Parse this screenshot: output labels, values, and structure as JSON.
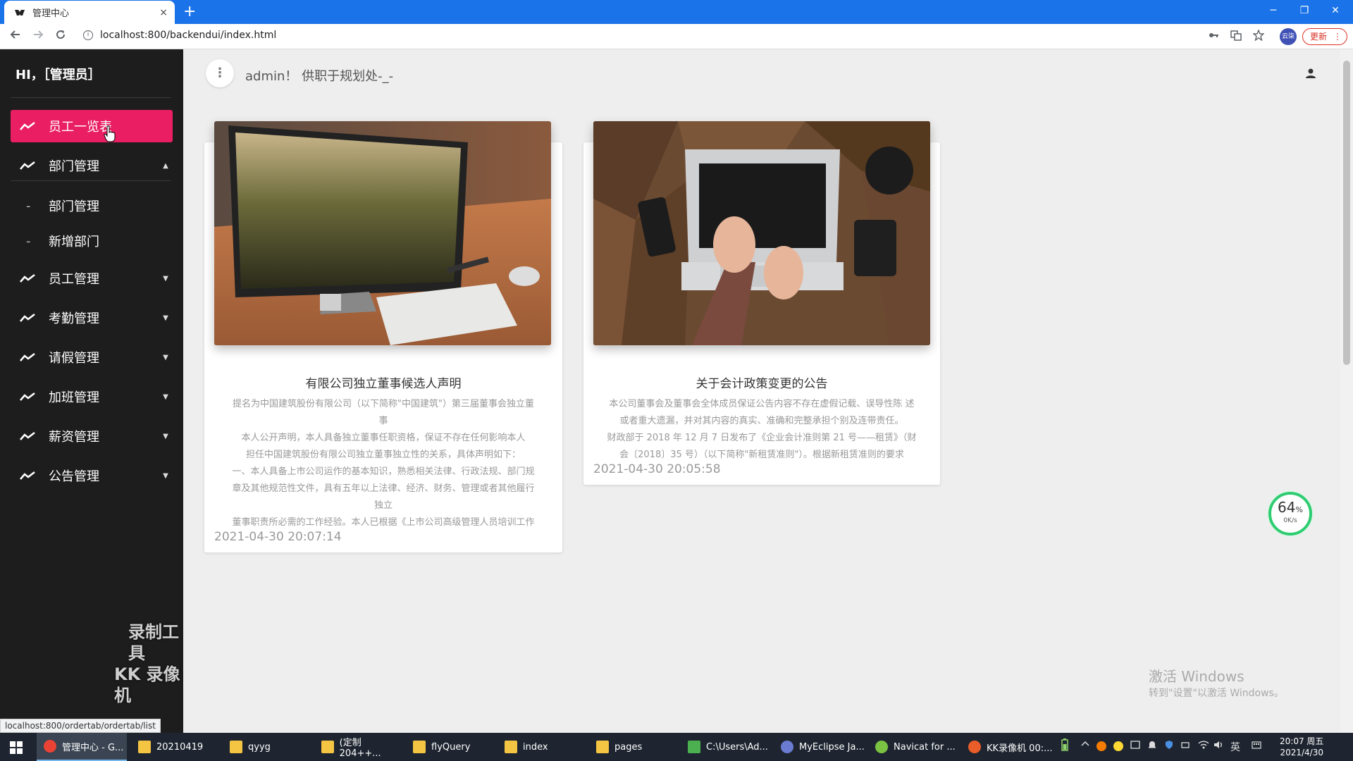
{
  "browser": {
    "tab_title": "管理中心",
    "close_glyph": "×",
    "new_tab_glyph": "+",
    "url": "localhost:800/backendui/index.html",
    "profile_text": "云柒",
    "update_label": "更新",
    "window_controls": [
      "─",
      "❐",
      "✕"
    ]
  },
  "sidebar": {
    "greeting": "HI，［管理员］",
    "items": [
      {
        "label": "员工一览表",
        "active": true,
        "caret": ""
      },
      {
        "label": "部门管理",
        "caret": "▲"
      },
      {
        "label": "员工管理",
        "caret": "▼"
      },
      {
        "label": "考勤管理",
        "caret": "▼"
      },
      {
        "label": "请假管理",
        "caret": "▼"
      },
      {
        "label": "加班管理",
        "caret": "▼"
      },
      {
        "label": "薪资管理",
        "caret": "▼"
      },
      {
        "label": "公告管理",
        "caret": "▼"
      }
    ],
    "sub_items": [
      {
        "label": "部门管理",
        "dash": "-"
      },
      {
        "label": "新增部门",
        "dash": "-"
      }
    ],
    "watermark_line1": "录制工具",
    "watermark_line2": "KK 录像机"
  },
  "status_bar_url": "localhost:800/ordertab/ordertab/list",
  "header": {
    "menu_glyph": "⋮",
    "greeting": "admin！ 供职于规划处-_-"
  },
  "cards": [
    {
      "title": "有限公司独立董事候选人声明",
      "body": [
        "提名为中国建筑股份有限公司（以下简称\"中国建筑\"）第三届董事会独立董",
        "事",
        "本人公开声明，本人具备独立董事任职资格，保证不存在任何影响本人",
        "担任中国建筑股份有限公司独立董事独立性的关系，具体声明如下：",
        "一、本人具备上市公司运作的基本知识，熟悉相关法律、行政法规、部门规",
        "章及其他规范性文件，具有五年以上法律、经济、财务、管理或者其他履行",
        "独立",
        "董事职责所必需的工作经验。本人已根据《上市公司高级管理人员培训工作"
      ],
      "date": "2021-04-30 20:07:14"
    },
    {
      "title": "关于会计政策变更的公告",
      "body": [
        "本公司董事会及董事会全体成员保证公告内容不存在虚假记载、误导性陈 述",
        "或者重大遗漏，并对其内容的真实、准确和完整承担个别及连带责任。",
        "财政部于 2018 年 12 月 7 日发布了《企业会计准则第 21 号——租赁》（财",
        "会〔2018〕35 号）（以下简称\"新租赁准则\"）。根据新租赁准则的要求"
      ],
      "date": "2021-04-30 20:05:58"
    }
  ],
  "speed_widget": {
    "percent": "64",
    "percent_sign": "%",
    "rate": "0K/s"
  },
  "activation": {
    "line1": "激活 Windows",
    "line2": "转到\"设置\"以激活 Windows。"
  },
  "taskbar": {
    "apps": [
      {
        "label": "管理中心 - G...",
        "color": "#ea4335"
      },
      {
        "label": "20210419",
        "color": "#f4c542"
      },
      {
        "label": "qyyg",
        "color": "#f4c542"
      },
      {
        "label": "(定制204++...",
        "color": "#f4c542"
      },
      {
        "label": "flyQuery",
        "color": "#f4c542"
      },
      {
        "label": "index",
        "color": "#f4c542"
      },
      {
        "label": "pages",
        "color": "#f4c542"
      },
      {
        "label": "C:\\Users\\Ad...",
        "color": "#4caf50"
      },
      {
        "label": "MyEclipse Ja...",
        "color": "#6a7bd1"
      },
      {
        "label": "Navicat for ...",
        "color": "#7cc242"
      },
      {
        "label": "KK录像机 00:...",
        "color": "#e85d2a"
      }
    ],
    "ime": "英",
    "time": "20:07 周五",
    "date": "2021/4/30"
  },
  "colors": {
    "accent": "#e91e63",
    "sidebar_bg": "#1d1d1d",
    "browser_blue": "#1a73e8"
  }
}
